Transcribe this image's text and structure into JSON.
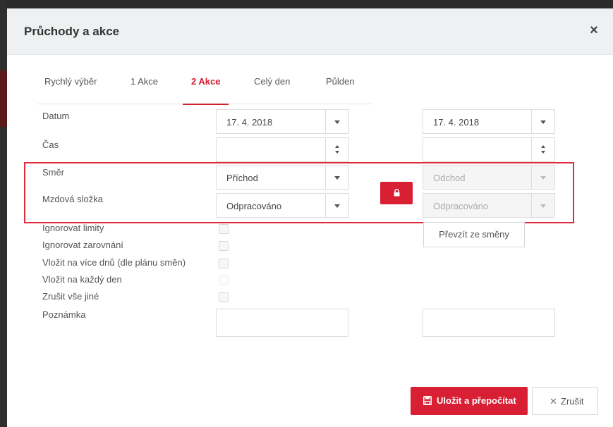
{
  "dialog": {
    "title": "Průchody a akce"
  },
  "tabs": [
    {
      "label": "Rychlý výběr"
    },
    {
      "label": "1 Akce"
    },
    {
      "label": "2 Akce"
    },
    {
      "label": "Celý den"
    },
    {
      "label": "Půlden"
    }
  ],
  "active_tab": "2 Akce",
  "labels": {
    "datum": "Datum",
    "cas": "Čas",
    "smer": "Směr",
    "mzdova_slozka": "Mzdová složka",
    "ignorovat_limity": "Ignorovat limity",
    "ignorovat_zarovnani": "Ignorovat zarovnání",
    "vlozit_vice_dnu": "Vložit na více dnů (dle plánu směn)",
    "vlozit_kazdy_den": "Vložit na každý den",
    "zrusit_vse_jine": "Zrušit vše jiné",
    "poznamka": "Poznámka"
  },
  "left": {
    "datum": "17. 4. 2018",
    "cas": "",
    "smer": "Příchod",
    "mzdova_slozka": "Odpracováno"
  },
  "right": {
    "datum": "17. 4. 2018",
    "cas": "",
    "smer": "Odchod",
    "mzdova_slozka": "Odpracováno"
  },
  "buttons": {
    "prevzit": "Převzít ze směny",
    "save": "Uložit a přepočítat",
    "cancel": "Zrušit"
  },
  "colors": {
    "accent": "#d91f33",
    "highlight_border": "#e02b3a"
  }
}
